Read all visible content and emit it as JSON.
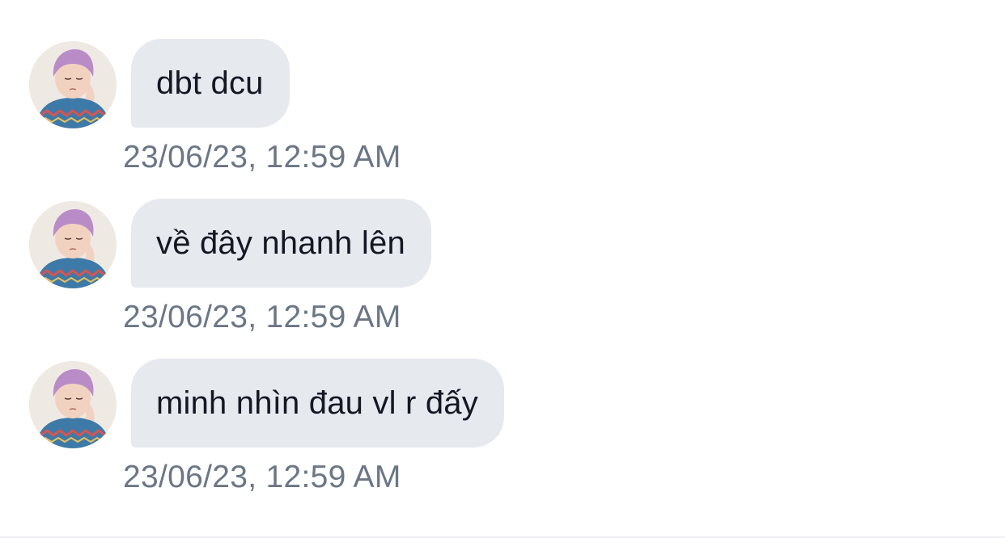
{
  "colors": {
    "background": "#ffffff",
    "bubble": "#e6e9ee",
    "message_text": "#141823",
    "timestamp_text": "#6b7686",
    "avatar_hair": "#b98cc7",
    "avatar_sweater": "#3e7aa8"
  },
  "messages": [
    {
      "avatar_icon": "profile-photo",
      "text": "dbt dcu",
      "timestamp": "23/06/23, 12:59 AM"
    },
    {
      "avatar_icon": "profile-photo",
      "text": "về đây nhanh lên",
      "timestamp": "23/06/23, 12:59 AM"
    },
    {
      "avatar_icon": "profile-photo",
      "text": "minh nhìn đau vl r đấy",
      "timestamp": "23/06/23, 12:59 AM"
    }
  ]
}
